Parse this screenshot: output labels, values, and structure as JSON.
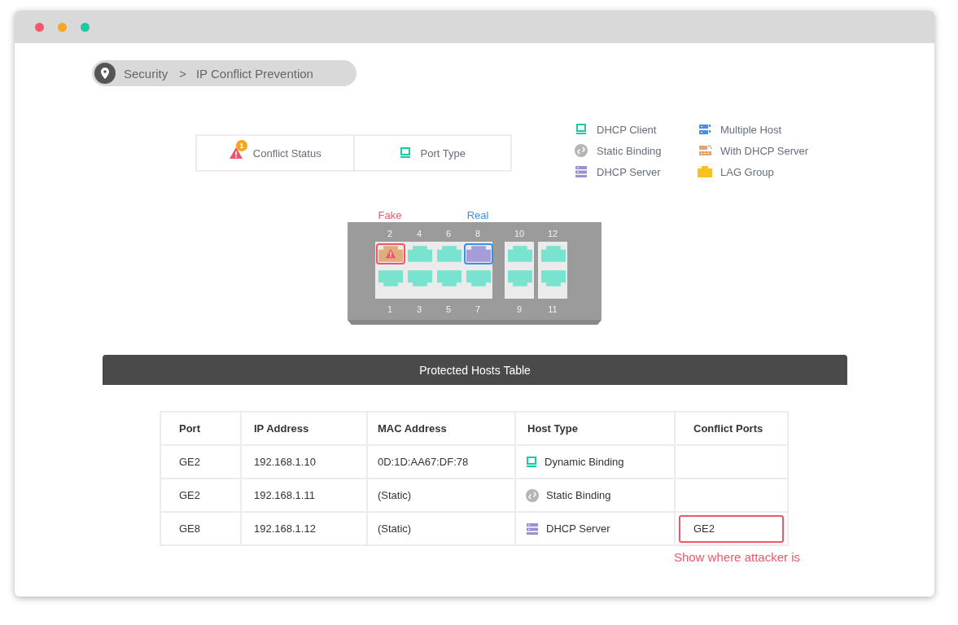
{
  "breadcrumb": {
    "items": [
      "Security",
      "IP Conflict Prevention"
    ],
    "separator": ">"
  },
  "tabs": [
    {
      "label": "Conflict Status",
      "kind": "conflict",
      "badge": "1"
    },
    {
      "label": "Port Type",
      "kind": "client"
    }
  ],
  "legend": [
    {
      "label": "DHCP Client",
      "kind": "client"
    },
    {
      "label": "Static Binding",
      "kind": "static"
    },
    {
      "label": "DHCP Server",
      "kind": "server"
    },
    {
      "label": "Multiple Host",
      "kind": "multi"
    },
    {
      "label": "With DHCP Server",
      "kind": "with_dhcp"
    },
    {
      "label": "LAG Group",
      "kind": "lag"
    }
  ],
  "switch": {
    "port_groups": [
      [
        {
          "top": {
            "number": "2",
            "kind": "with_dhcp",
            "alert": true,
            "tag": "Fake",
            "color": "#f0566a"
          },
          "bottom": {
            "number": "1",
            "kind": "client",
            "alert": false
          }
        },
        {
          "top": {
            "number": "4",
            "kind": "client",
            "alert": false
          },
          "bottom": {
            "number": "3",
            "kind": "client",
            "alert": false
          }
        },
        {
          "top": {
            "number": "6",
            "kind": "client",
            "alert": false
          },
          "bottom": {
            "number": "5",
            "kind": "client",
            "alert": false
          }
        },
        {
          "top": {
            "number": "8",
            "kind": "server",
            "alert": false,
            "tag": "Real",
            "color": "#3d8fe6"
          },
          "bottom": {
            "number": "7",
            "kind": "client",
            "alert": false
          }
        }
      ],
      [
        {
          "top": {
            "number": "10",
            "kind": "client",
            "alert": false
          },
          "bottom": {
            "number": "9",
            "kind": "client",
            "alert": false
          }
        }
      ],
      [
        {
          "top": {
            "number": "12",
            "kind": "client",
            "alert": false
          },
          "bottom": {
            "number": "11",
            "kind": "client",
            "alert": false
          }
        }
      ]
    ]
  },
  "table": {
    "title": "Protected Hosts Table",
    "columns": [
      "Port",
      "IP Address",
      "MAC Address",
      "Host Type",
      "Conflict Ports"
    ],
    "rows": [
      {
        "port": "GE2",
        "ip": "192.168.1.10",
        "mac": "0D:1D:AA67:DF:78",
        "host_type": {
          "label": "Dynamic Binding",
          "kind": "client"
        }
      },
      {
        "port": "GE2",
        "ip": "192.168.1.11",
        "mac": "(Static)",
        "host_type": {
          "label": "Static Binding",
          "kind": "static"
        }
      },
      {
        "port": "GE8",
        "ip": "192.168.1.12",
        "mac": "(Static)",
        "host_type": {
          "label": "DHCP Server",
          "kind": "server"
        },
        "conflict_port": "GE2",
        "highlighted": true
      }
    ],
    "note": "Show where attacker is"
  }
}
